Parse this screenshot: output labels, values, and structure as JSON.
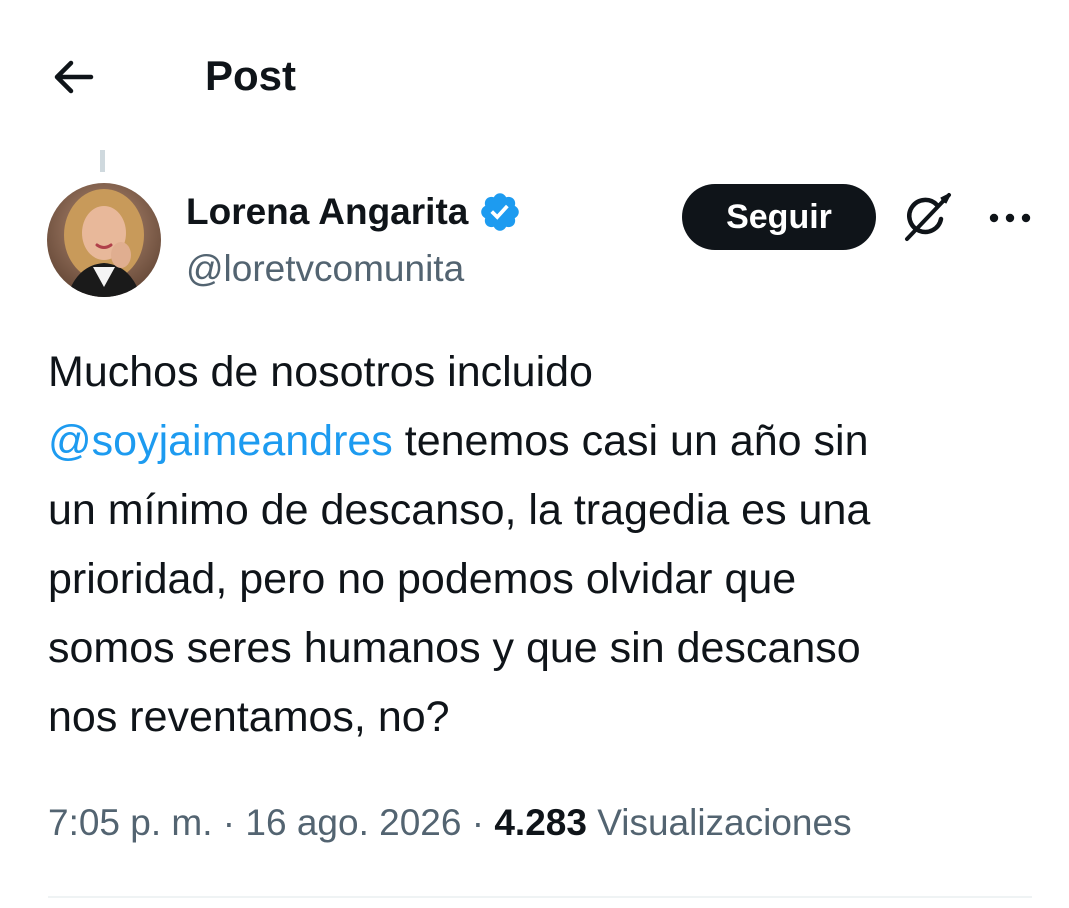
{
  "header": {
    "title": "Post",
    "back_icon": "arrow-left-icon"
  },
  "author": {
    "name": "Lorena Angarita",
    "handle": "@loretvcomunita",
    "verified": true,
    "verified_color": "#1d9bf0",
    "avatar_icon": "profile-photo"
  },
  "actions": {
    "follow_label": "Seguir",
    "grok_icon": "grok-icon",
    "more_icon": "more-dots-icon"
  },
  "tweet": {
    "line1": "Muchos de nosotros incluido",
    "mention": "@soyjaimeandres",
    "line2_rest": " tenemos casi un año sin",
    "line3": "un mínimo de descanso, la tragedia es una",
    "line4": "prioridad, pero no podemos olvidar que",
    "line5": "somos seres humanos y que sin descanso",
    "line6": "nos reventamos, no?"
  },
  "meta": {
    "time": "7:05 p. m.",
    "separator": " · ",
    "date": "16 ago. 2026",
    "views_count": "4.283",
    "views_label": "Visualizaciones"
  },
  "colors": {
    "text": "#0f1419",
    "secondary": "#536471",
    "link": "#1d9bf0",
    "follow_bg": "#0f1419"
  }
}
